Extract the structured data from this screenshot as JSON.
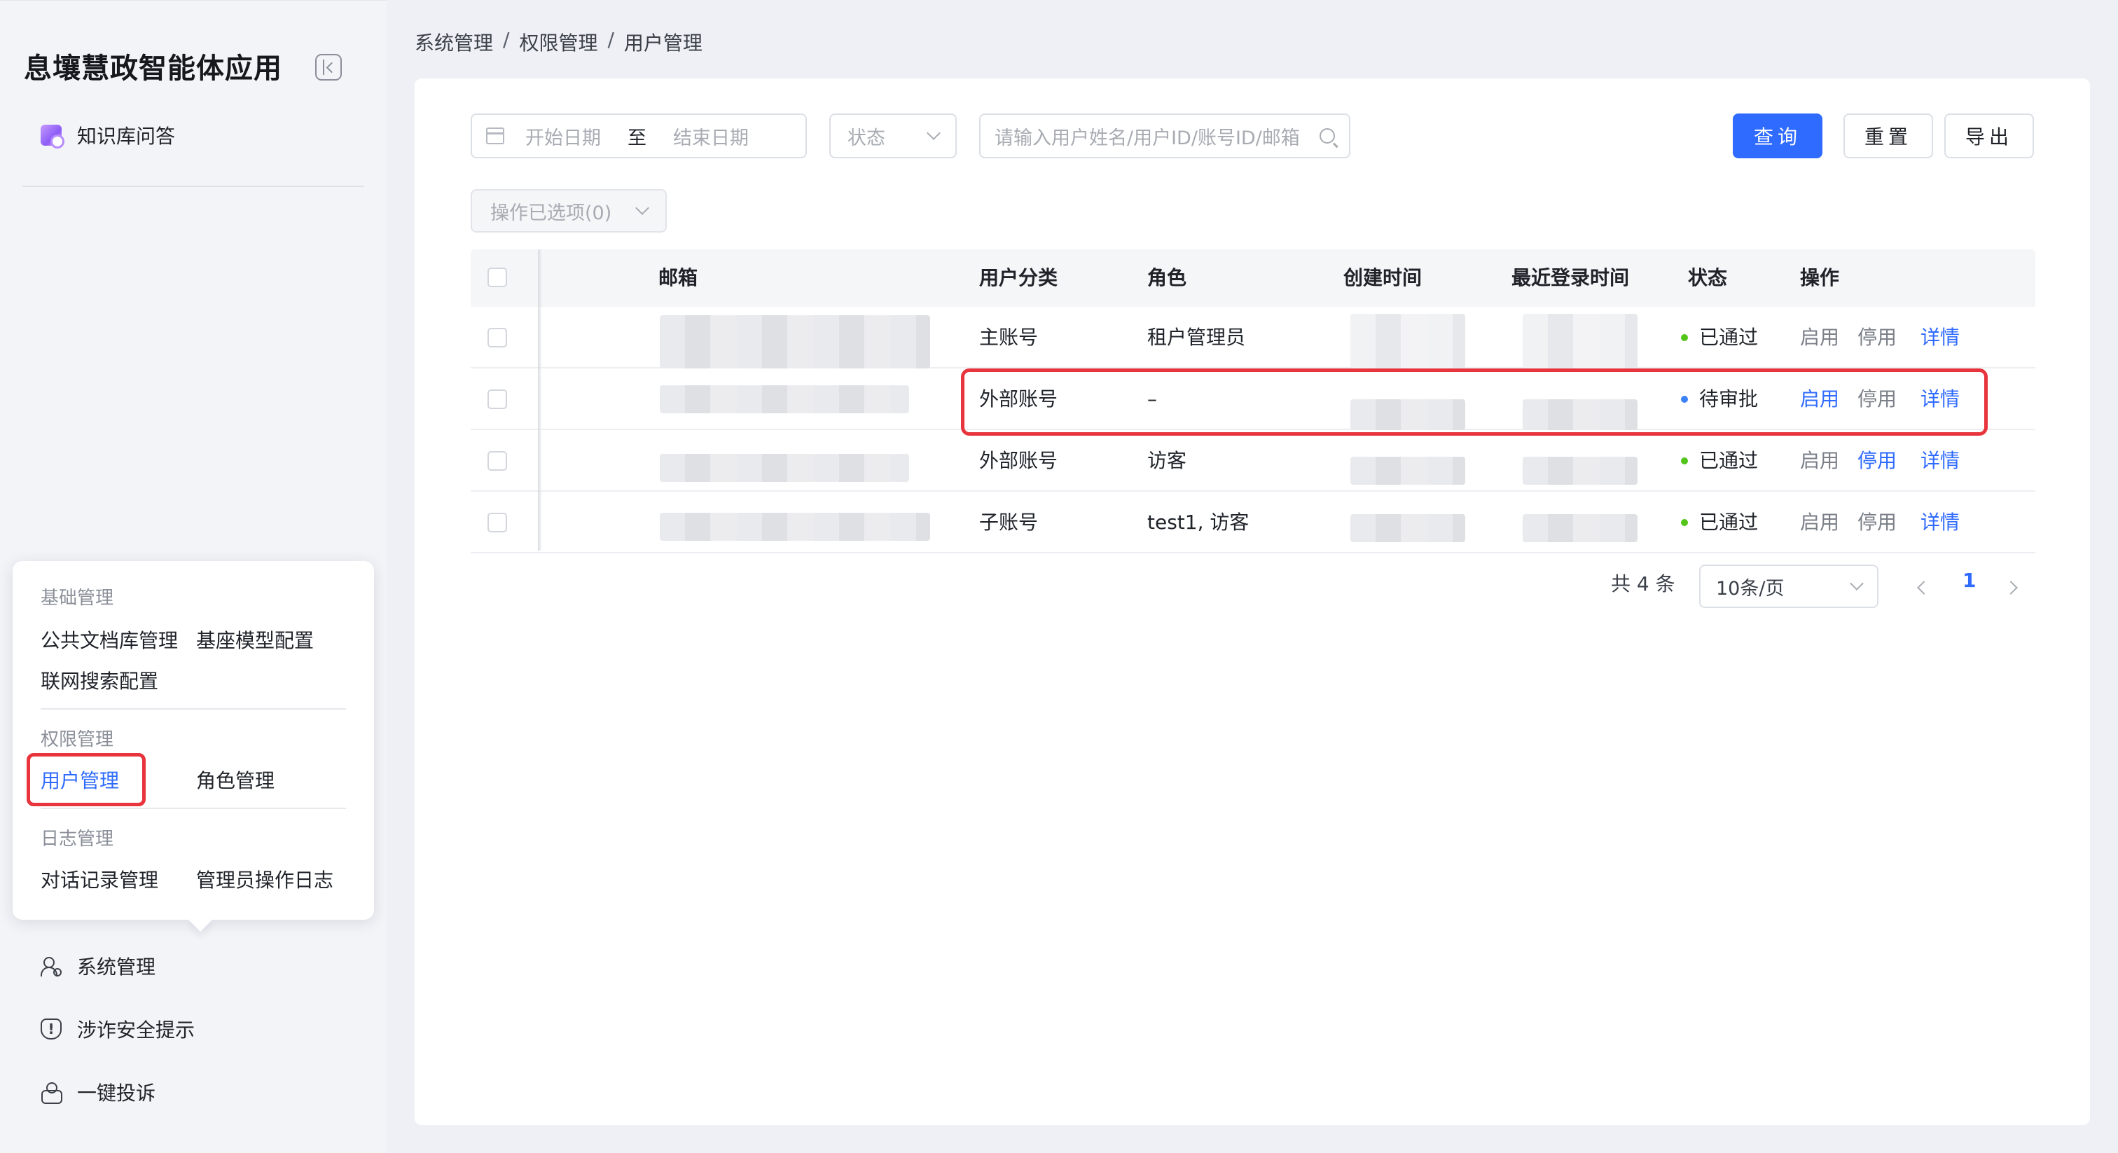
{
  "app": {
    "title": "息壤慧政智能体应用"
  },
  "sidebar": {
    "knowledge_qa": "知识库问答",
    "popover": {
      "groups": [
        {
          "title": "基础管理",
          "items": [
            "公共文档库管理",
            "基座模型配置",
            "联网搜索配置"
          ]
        },
        {
          "title": "权限管理",
          "items": [
            "用户管理",
            "角色管理"
          ],
          "active": "用户管理"
        },
        {
          "title": "日志管理",
          "items": [
            "对话记录管理",
            "管理员操作日志"
          ]
        }
      ]
    },
    "bottom_items": [
      "系统管理",
      "涉诈安全提示",
      "一键投诉"
    ]
  },
  "breadcrumb": [
    "系统管理",
    "权限管理",
    "用户管理"
  ],
  "filters": {
    "start_date_placeholder": "开始日期",
    "range_separator": "至",
    "end_date_placeholder": "结束日期",
    "status_placeholder": "状态",
    "search_placeholder": "请输入用户姓名/用户ID/账号ID/邮箱"
  },
  "buttons": {
    "query": "查询",
    "reset": "重置",
    "export": "导出",
    "batch": "操作已选项(0)"
  },
  "table": {
    "columns": [
      "邮箱",
      "用户分类",
      "角色",
      "创建时间",
      "最近登录时间",
      "状态",
      "操作"
    ],
    "rows": [
      {
        "category": "主账号",
        "role": "租户管理员",
        "status": "已通过",
        "status_color": "#52c41a"
      },
      {
        "category": "外部账号",
        "role": "–",
        "status": "待审批",
        "status_color": "#3b82f6"
      },
      {
        "category": "外部账号",
        "role": "访客",
        "status": "已通过",
        "status_color": "#52c41a"
      },
      {
        "category": "子账号",
        "role": "test1, 访客",
        "status": "已通过",
        "status_color": "#52c41a"
      }
    ],
    "actions": {
      "enable": "启用",
      "disable": "停用",
      "detail": "详情"
    }
  },
  "pagination": {
    "total": "共 4 条",
    "page_size": "10条/页",
    "current_page": "1"
  },
  "colors": {
    "primary": "#2f6bff",
    "highlight_red": "#e8343c"
  }
}
